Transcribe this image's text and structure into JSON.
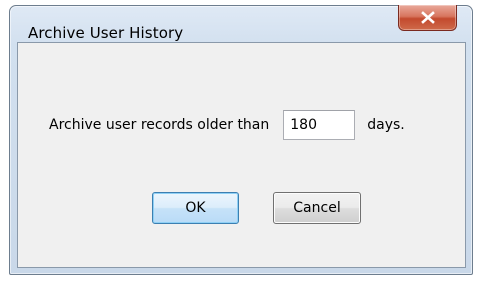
{
  "dialog": {
    "title": "Archive User History",
    "close_icon": "close-x-icon",
    "prompt_label": "Archive user records older than",
    "days_value": "180",
    "unit_label": "days.",
    "ok_label": "OK",
    "cancel_label": "Cancel"
  },
  "colors": {
    "close_button": "#c9503a",
    "ok_border": "#3c7fb1",
    "client_background": "#f0f0f0"
  }
}
